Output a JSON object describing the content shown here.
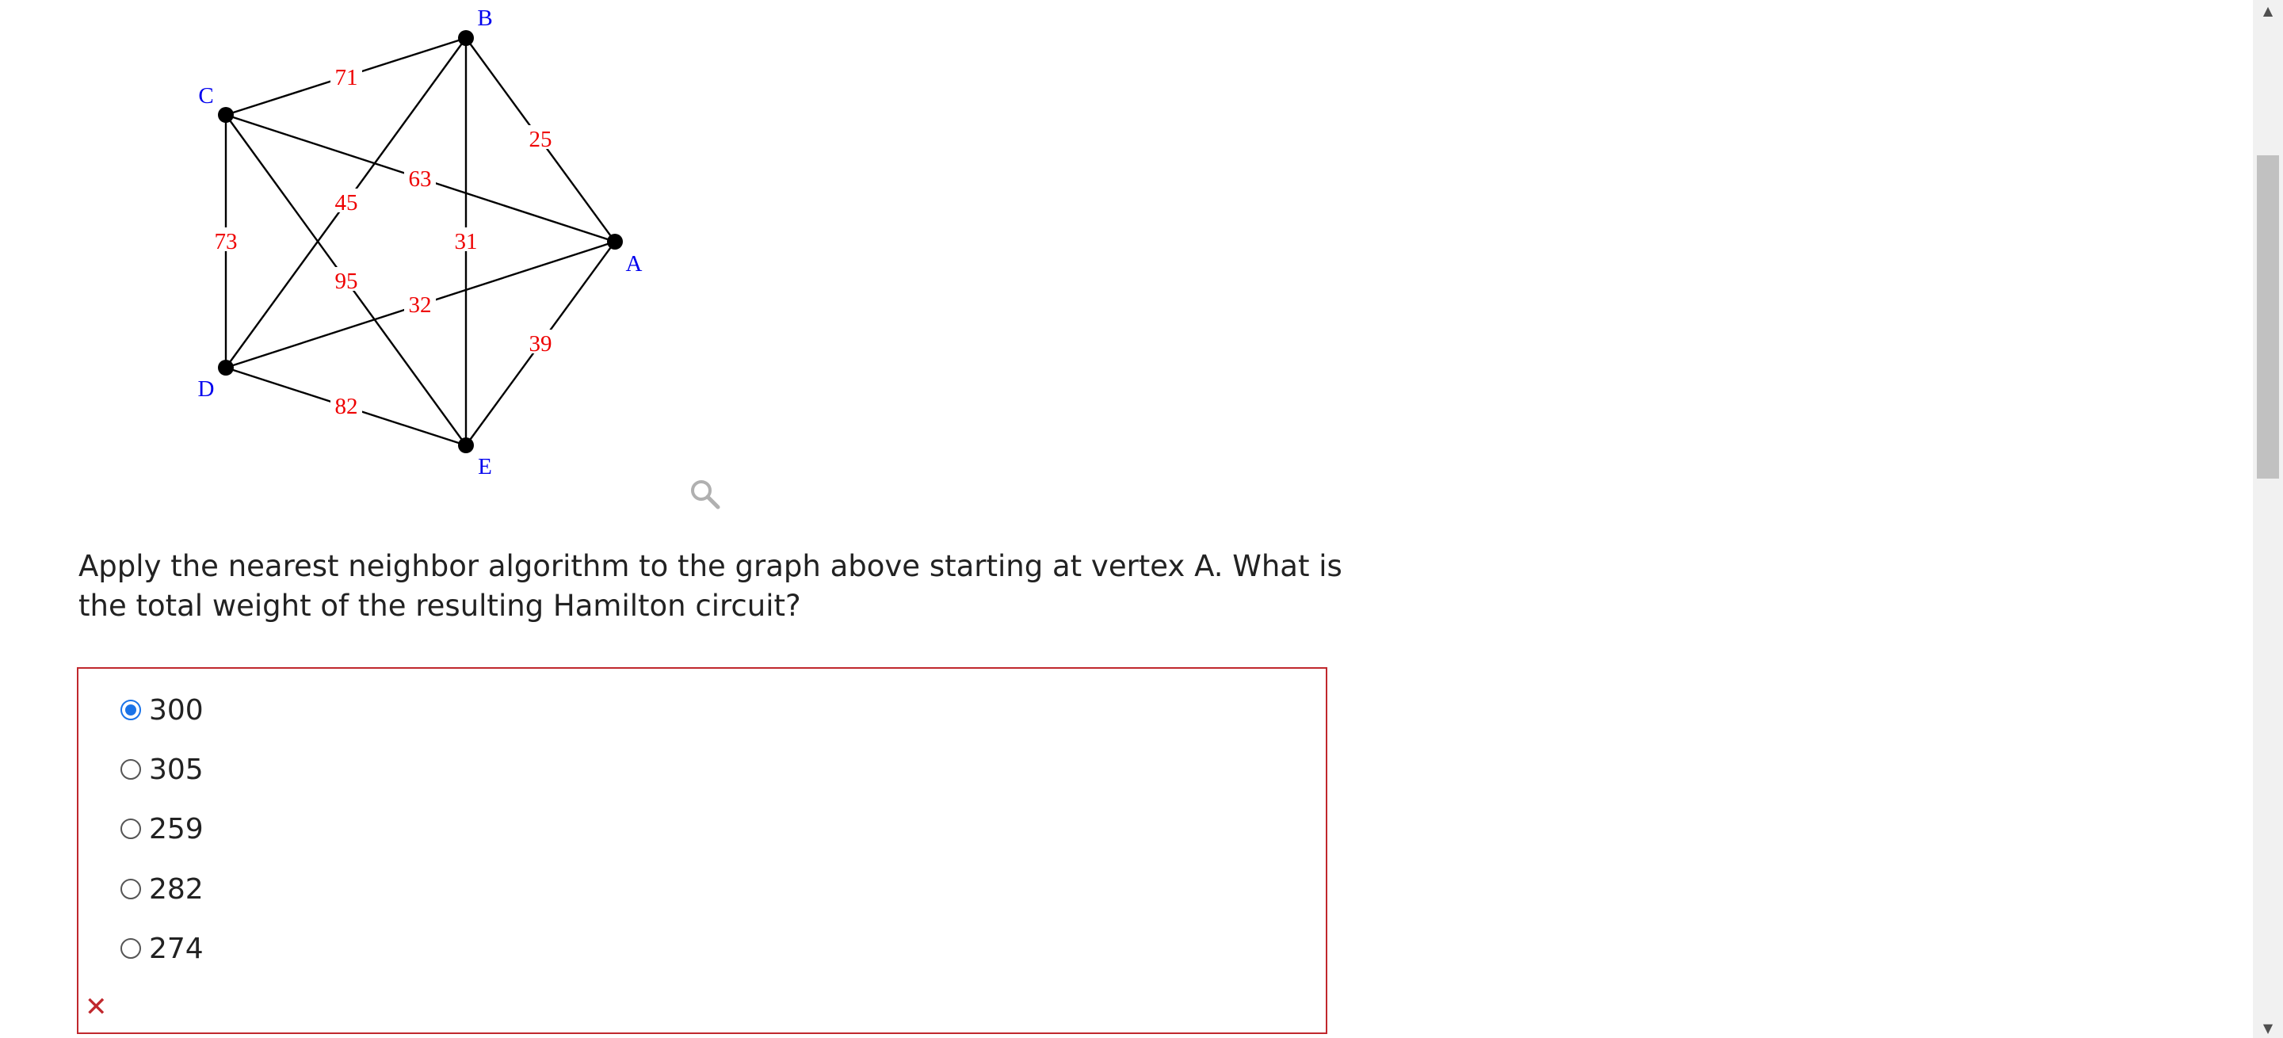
{
  "graph": {
    "vertices": [
      {
        "id": "A",
        "label": "A"
      },
      {
        "id": "B",
        "label": "B"
      },
      {
        "id": "C",
        "label": "C"
      },
      {
        "id": "D",
        "label": "D"
      },
      {
        "id": "E",
        "label": "E"
      }
    ],
    "edges": [
      {
        "from": "B",
        "to": "C",
        "weight": "71"
      },
      {
        "from": "B",
        "to": "A",
        "weight": "25"
      },
      {
        "from": "C",
        "to": "A",
        "weight": "63"
      },
      {
        "from": "B",
        "to": "D",
        "weight": "45"
      },
      {
        "from": "B",
        "to": "E",
        "weight": "31"
      },
      {
        "from": "C",
        "to": "D",
        "weight": "73"
      },
      {
        "from": "C",
        "to": "E",
        "weight": "95"
      },
      {
        "from": "D",
        "to": "A",
        "weight": "32"
      },
      {
        "from": "E",
        "to": "A",
        "weight": "39"
      },
      {
        "from": "D",
        "to": "E",
        "weight": "82"
      }
    ],
    "colors": {
      "vertex_label": "#0000ee",
      "weight_label": "#ee0000"
    }
  },
  "zoom_icon": "magnifier-icon",
  "question": {
    "text": "Apply the nearest neighbor algorithm to the graph above starting at vertex A. What is the total weight of the resulting Hamilton circuit?"
  },
  "answers": {
    "options": [
      "300",
      "305",
      "259",
      "282",
      "274"
    ],
    "selected": "300",
    "status_icon": "x-icon",
    "status_color": "#c0282d"
  },
  "scrollbar": {
    "up_arrow": "▲",
    "down_arrow": "▼"
  }
}
